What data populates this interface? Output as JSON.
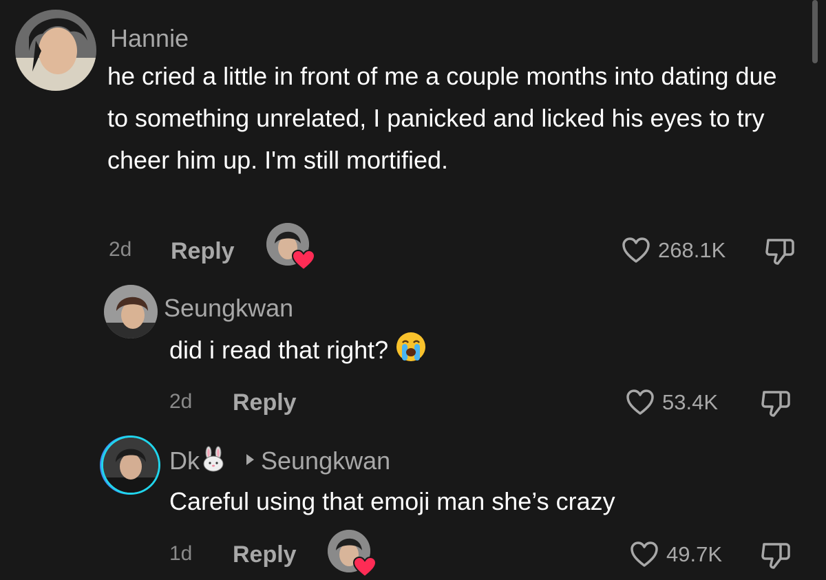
{
  "colors": {
    "background": "#181818",
    "text": "#ffffff",
    "muted": "#a8a8a8",
    "heart": "#fe2c55",
    "ring": "#20d5ec"
  },
  "comments": [
    {
      "username": "Hannie",
      "text": "he cried a little in front of me a couple months into dating due to something unrelated, I panicked and licked his eyes to try cheer him up. I'm still mortified.",
      "time": "2d",
      "reply_label": "Reply",
      "likes": "268.1K",
      "liked_by_creator": true
    },
    {
      "username": "Seungkwan",
      "text": "did i read that right?",
      "emoji": "loudly-crying-face",
      "time": "2d",
      "reply_label": "Reply",
      "likes": "53.4K",
      "liked_by_creator": false
    },
    {
      "username": "Dk",
      "username_emoji": "rabbit-face",
      "reply_to": "Seungkwan",
      "text": "Careful using that emoji man she’s crazy",
      "time": "1d",
      "reply_label": "Reply",
      "likes": "49.7K",
      "liked_by_creator": true
    }
  ]
}
